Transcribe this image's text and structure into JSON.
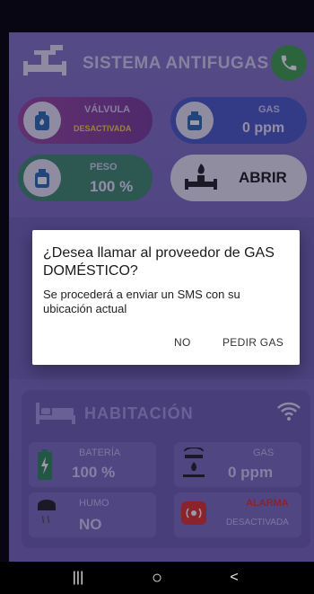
{
  "header": {
    "title": "SISTEMA ANTIFUGAS"
  },
  "status": {
    "valve": {
      "label": "VÁLVULA",
      "value": "DESACTIVADA",
      "color": "#ffd54a"
    },
    "gas": {
      "label": "GAS",
      "value": "0 ppm"
    },
    "weight": {
      "label": "PESO",
      "value": "100 %"
    },
    "action": {
      "label": "ABRIR"
    }
  },
  "room": {
    "title": "HABITACIÓN",
    "battery": {
      "label": "BATERÍA",
      "value": "100 %"
    },
    "gas": {
      "label": "GAS",
      "value": "0 ppm"
    },
    "smoke": {
      "label": "HUMO",
      "value": "NO"
    },
    "alarm": {
      "label": "ALARMA",
      "value": "DESACTIVADA"
    }
  },
  "dialog": {
    "title": "¿Desea llamar al proveedor de GAS DOMÉSTICO?",
    "message": "Se procederá a enviar un SMS con su ubicación actual",
    "no_label": "NO",
    "confirm_label": "PEDIR GAS"
  },
  "nav": {
    "recents": "|||",
    "home": "○",
    "back": "<"
  },
  "colors": {
    "app_bg": "#8576c6",
    "call": "#3fa34a",
    "valve_pill": "#8a449c",
    "gas_pill": "#4a5cc7",
    "weight_pill": "#3f8e6b",
    "alarm_red": "#e0322c"
  }
}
